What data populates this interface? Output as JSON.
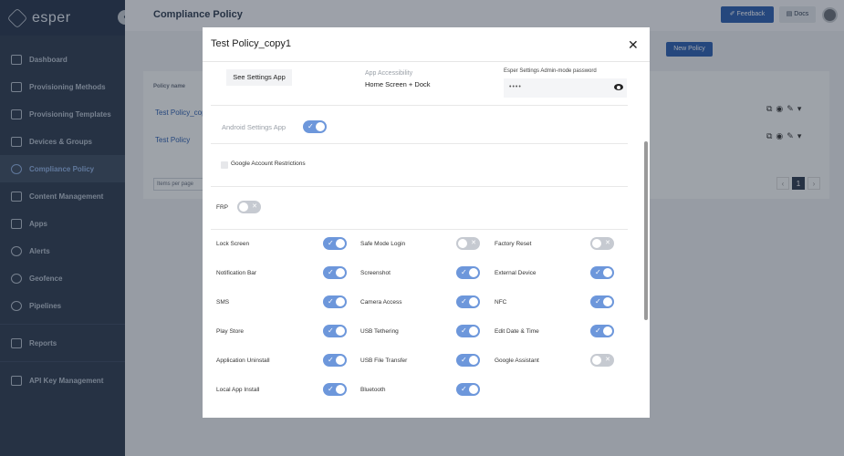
{
  "sidebar": {
    "brand": "esper",
    "items": [
      {
        "label": "Dashboard",
        "icon": "dashboard-icon"
      },
      {
        "label": "Provisioning Methods",
        "icon": "provisioning-icon"
      },
      {
        "label": "Provisioning Templates",
        "icon": "template-icon"
      },
      {
        "label": "Devices & Groups",
        "icon": "devices-icon"
      },
      {
        "label": "Compliance Policy",
        "icon": "shield-icon"
      },
      {
        "label": "Content Management",
        "icon": "folder-icon"
      },
      {
        "label": "Apps",
        "icon": "apps-icon"
      },
      {
        "label": "Alerts",
        "icon": "bell-icon"
      },
      {
        "label": "Geofence",
        "icon": "geofence-icon"
      },
      {
        "label": "Pipelines",
        "icon": "infinity-icon"
      },
      {
        "label": "Reports",
        "icon": "reports-icon"
      },
      {
        "label": "API Key Management",
        "icon": "key-icon"
      }
    ]
  },
  "header": {
    "title": "Compliance Policy",
    "feedback_label": "✐ Feedback",
    "docs_label": "▤ Docs"
  },
  "page": {
    "new_policy_label": "New Policy",
    "column_policy_name": "Policy name",
    "rows": [
      "Test Policy_cop",
      "Test Policy"
    ],
    "items_per_page": "Items per page",
    "current_page": "1"
  },
  "modal": {
    "title": "Test Policy_copy1",
    "close": "✕",
    "see_settings_label": "See Settings App",
    "app_accessibility_label": "App Accessibility",
    "app_accessibility_value": "Home Screen + Dock",
    "password_label": "Esper Settings Admin-mode password",
    "password_value": "••••",
    "android_settings_label": "Android Settings App",
    "google_restrictions_label": "Google Account Restrictions",
    "frp_label": "FRP",
    "toggles": [
      {
        "label": "Lock Screen",
        "on": true
      },
      {
        "label": "Safe Mode Login",
        "on": false
      },
      {
        "label": "Factory Reset",
        "on": false
      },
      {
        "label": "Notification Bar",
        "on": true
      },
      {
        "label": "Screenshot",
        "on": true
      },
      {
        "label": "External Device",
        "on": true
      },
      {
        "label": "SMS",
        "on": true
      },
      {
        "label": "Camera Access",
        "on": true
      },
      {
        "label": "NFC",
        "on": true
      },
      {
        "label": "Play Store",
        "on": true
      },
      {
        "label": "USB Tethering",
        "on": true
      },
      {
        "label": "Edit Date & Time",
        "on": true
      },
      {
        "label": "Application Uninstall",
        "on": true
      },
      {
        "label": "USB File Transfer",
        "on": true
      },
      {
        "label": "Google Assistant",
        "on": false
      },
      {
        "label": "Local App Install",
        "on": true
      },
      {
        "label": "Bluetooth",
        "on": true
      }
    ]
  },
  "colors": {
    "sidebar": "#2b3a4f",
    "accent": "#2a5db0",
    "toggle_on": "#6d97db",
    "toggle_off": "#c6cad1"
  }
}
